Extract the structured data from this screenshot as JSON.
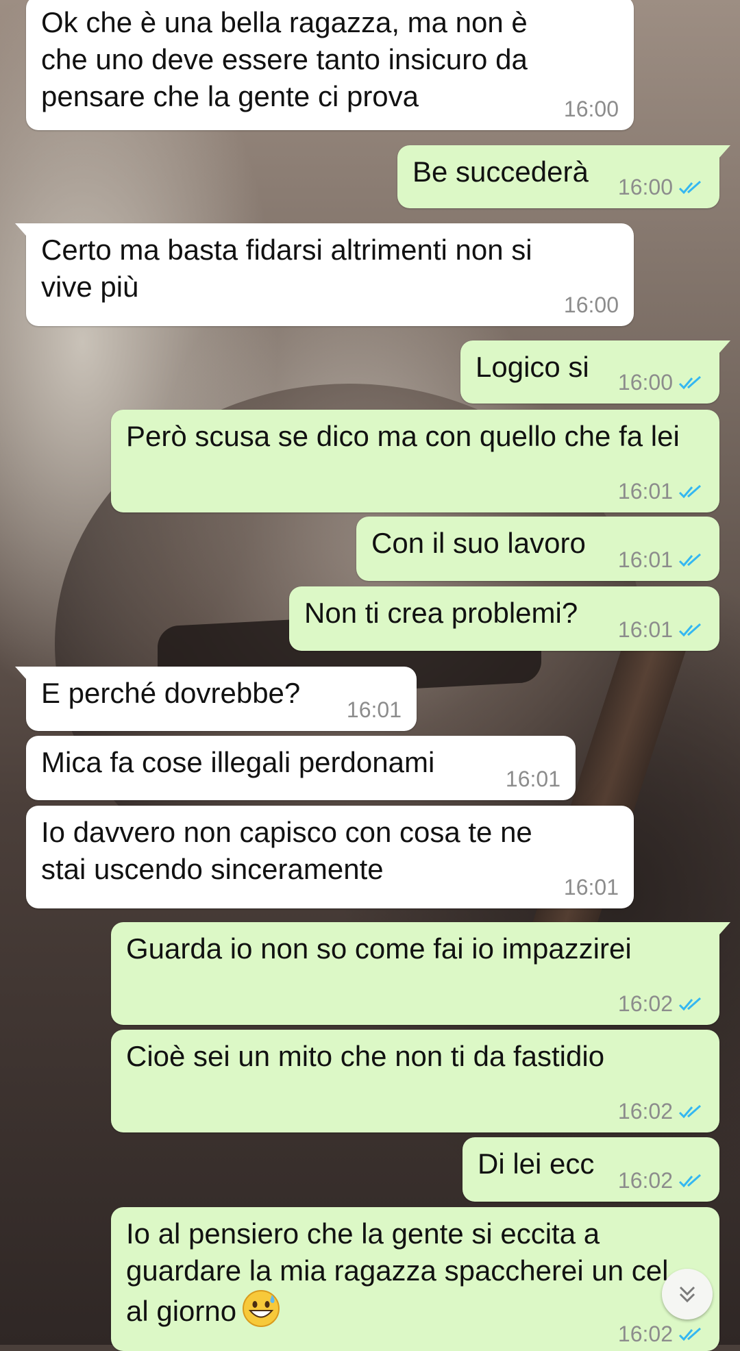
{
  "chat": {
    "messages": [
      {
        "dir": "in",
        "text": "Ok che è una bella ragazza, ma non è che uno deve essere tanto insicuro da pensare che la gente ci prova",
        "time": "16:00"
      },
      {
        "dir": "out",
        "text": "Be succederà",
        "time": "16:00"
      },
      {
        "dir": "in",
        "text": "Certo ma basta fidarsi altrimenti non si vive più",
        "time": "16:00"
      },
      {
        "dir": "out",
        "text": "Logico si",
        "time": "16:00"
      },
      {
        "dir": "out",
        "text": "Però scusa se dico ma con quello che fa lei",
        "time": "16:01"
      },
      {
        "dir": "out",
        "text": "Con il suo lavoro",
        "time": "16:01"
      },
      {
        "dir": "out",
        "text": "Non ti crea problemi?",
        "time": "16:01"
      },
      {
        "dir": "in",
        "text": "E perché dovrebbe?",
        "time": "16:01"
      },
      {
        "dir": "in",
        "text": "Mica fa cose illegali perdonami",
        "time": "16:01"
      },
      {
        "dir": "in",
        "text": "Io davvero non capisco con cosa te ne stai uscendo sinceramente",
        "time": "16:01"
      },
      {
        "dir": "out",
        "text": "Guarda io non so come fai io impazzirei",
        "time": "16:02"
      },
      {
        "dir": "out",
        "text": "Cioè sei un mito che non ti da fastidio",
        "time": "16:02"
      },
      {
        "dir": "out",
        "text": "Di lei ecc",
        "time": "16:02"
      },
      {
        "dir": "out",
        "text": "Io al pensiero che la gente si eccita a guardare la mia ragazza spaccherei un cel al giorno",
        "time": "16:02",
        "emoji": "grinning-face-with-sweat-emoji"
      }
    ]
  },
  "icons": {
    "read_receipt": "double-check-icon",
    "scroll_down": "chevron-double-down-icon"
  },
  "colors": {
    "incoming": "#ffffff",
    "outgoing": "#dcf8c6",
    "read_ticks": "#34b7f1",
    "timestamp": "#8c8c8c"
  }
}
